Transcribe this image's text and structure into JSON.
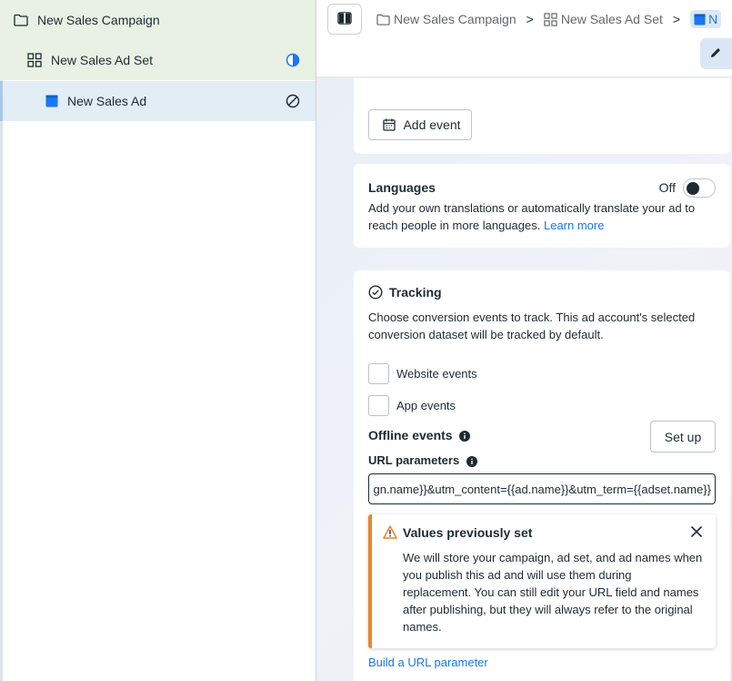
{
  "sidebar": {
    "campaign": {
      "label": "New Sales Campaign",
      "icon": "folder-icon"
    },
    "adset": {
      "label": "New Sales Ad Set",
      "icon": "grid-icon",
      "status_icon": "half-circle-icon"
    },
    "ad": {
      "label": "New Sales Ad",
      "icon": "ad-icon",
      "status_icon": "blocked-icon"
    }
  },
  "breadcrumb": {
    "campaign": "New Sales Campaign",
    "adset": "New Sales Ad Set",
    "ad": "N",
    "separator": ">"
  },
  "events": {
    "add_event_label": "Add event"
  },
  "languages": {
    "title": "Languages",
    "toggle_state": "Off",
    "description": "Add your own translations or automatically translate your ad to reach people in more languages.",
    "learn_more": "Learn more"
  },
  "tracking": {
    "title": "Tracking",
    "description": "Choose conversion events to track. This ad account's selected conversion dataset will be tracked by default.",
    "website_events": "Website events",
    "app_events": "App events",
    "offline_events": "Offline events",
    "setup_label": "Set up",
    "url_parameters_label": "URL parameters",
    "url_value": "utm_campaign={{campaign.name}}&utm_content={{ad.name}}&utm_term={{adset.name}}",
    "warning": {
      "title": "Values previously set",
      "body": "We will store your campaign, ad set, and ad names when you publish this ad and will use them during replacement. You can still edit your URL field and names after publishing, but they will always refer to the original names."
    },
    "build_url_link": "Build a URL parameter"
  },
  "colors": {
    "accent": "#1877f2",
    "warning": "#e8852b",
    "selected_green": "#e8f1e3",
    "selected_blue": "#e2edf5"
  }
}
